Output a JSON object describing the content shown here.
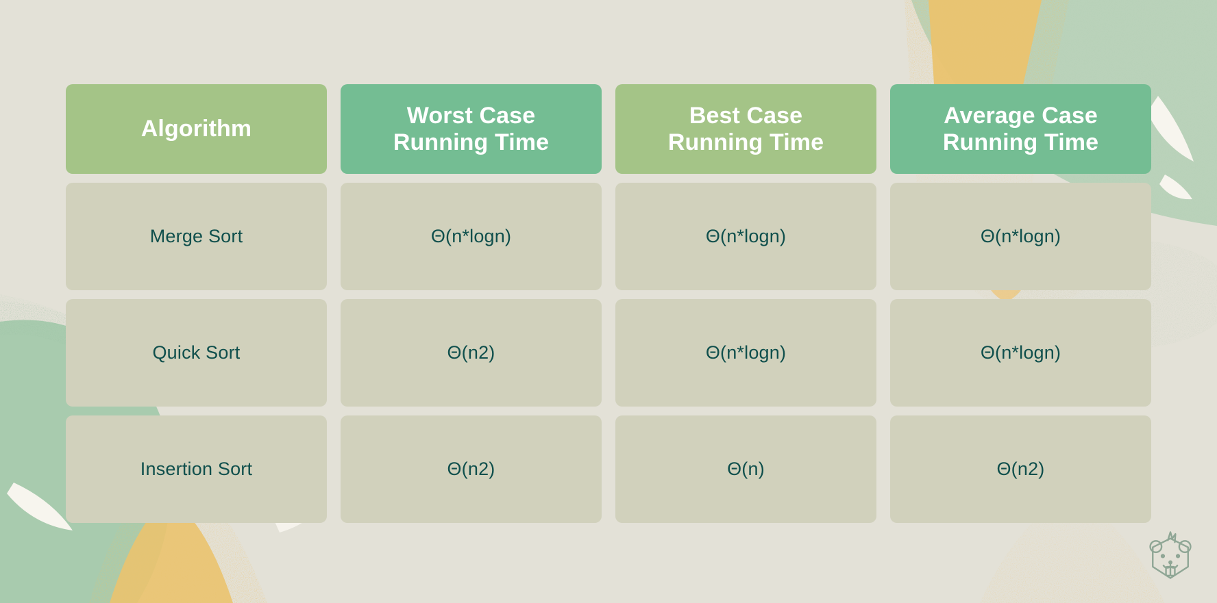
{
  "theme": {
    "page_background": "#e3e1d7",
    "header_tone_a": "#a4c487",
    "header_tone_b": "#74bd93",
    "body_cell_background": "#d1d1bc",
    "body_text_color": "#0f4f4c",
    "header_text_color": "#ffffff",
    "decor_green": "#a8cbae",
    "decor_orange": "#edc87e",
    "decor_white": "#f6f4ec"
  },
  "table": {
    "columns": [
      {
        "id": "algorithm",
        "label": "Algorithm",
        "tone": "tone-a"
      },
      {
        "id": "worst-case",
        "label": "Worst Case\nRunning Time",
        "tone": "tone-b"
      },
      {
        "id": "best-case",
        "label": "Best Case\nRunning Time",
        "tone": "tone-a"
      },
      {
        "id": "average-case",
        "label": "Average Case\nRunning Time",
        "tone": "tone-b"
      }
    ],
    "rows": [
      {
        "id": "merge-sort",
        "algorithm": "Merge Sort",
        "worst_case": "Θ(n*logn)",
        "best_case": "Θ(n*logn)",
        "average_case": "Θ(n*logn)"
      },
      {
        "id": "quick-sort",
        "algorithm": "Quick Sort",
        "worst_case": "Θ(n2)",
        "best_case": "Θ(n*logn)",
        "average_case": "Θ(n*logn)"
      },
      {
        "id": "insertion-sort",
        "algorithm": "Insertion Sort",
        "worst_case": "Θ(n2)",
        "best_case": "Θ(n)",
        "average_case": "Θ(n2)"
      }
    ]
  },
  "branding": {
    "logo_name": "beaver-mascot-icon"
  }
}
